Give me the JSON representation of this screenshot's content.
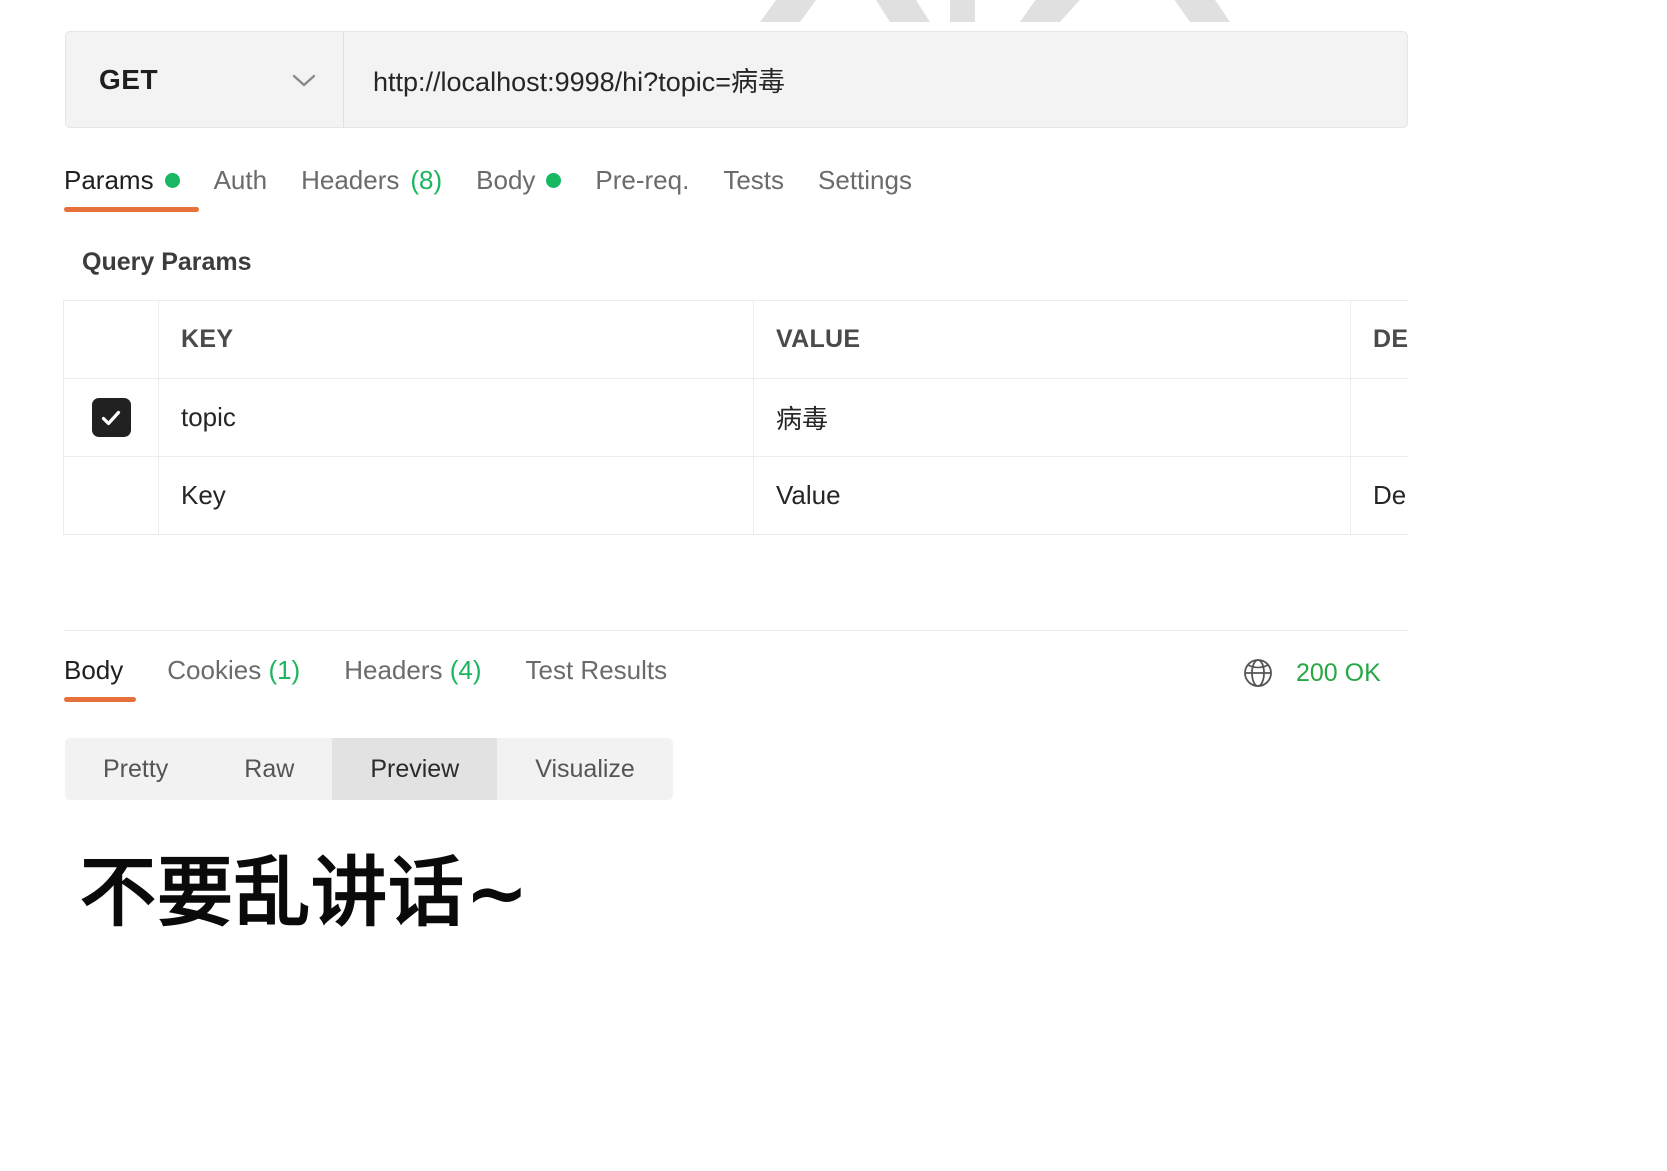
{
  "request": {
    "method": "GET",
    "method_chevron_icon": "chevron-down-icon",
    "url": "http://localhost:9998/hi?topic=病毒",
    "tabs": [
      {
        "label": "Params",
        "has_dot": true,
        "active": true
      },
      {
        "label": "Auth",
        "has_dot": false,
        "active": false
      },
      {
        "label": "Headers",
        "count": "(8)",
        "has_dot": false,
        "active": false
      },
      {
        "label": "Body",
        "has_dot": true,
        "active": false
      },
      {
        "label": "Pre-req.",
        "has_dot": false,
        "active": false
      },
      {
        "label": "Tests",
        "has_dot": false,
        "active": false
      },
      {
        "label": "Settings",
        "has_dot": false,
        "active": false
      }
    ]
  },
  "query_params": {
    "section_title": "Query Params",
    "columns": {
      "key": "KEY",
      "value": "VALUE",
      "description": "DE"
    },
    "rows": [
      {
        "checked": true,
        "check_icon": "checkmark-icon",
        "key": "topic",
        "value": "病毒",
        "description": ""
      }
    ],
    "placeholder_row": {
      "key": "Key",
      "value": "Value",
      "description": "De"
    }
  },
  "response": {
    "tabs": [
      {
        "label": "Body",
        "active": true
      },
      {
        "label": "Cookies",
        "count": "(1)",
        "active": false
      },
      {
        "label": "Headers",
        "count": "(4)",
        "active": false
      },
      {
        "label": "Test Results",
        "active": false
      }
    ],
    "status": {
      "globe_icon": "globe-icon",
      "text": "200 OK"
    },
    "view_modes": [
      {
        "label": "Pretty",
        "active": false
      },
      {
        "label": "Raw",
        "active": false
      },
      {
        "label": "Preview",
        "active": true
      },
      {
        "label": "Visualize",
        "active": false
      }
    ],
    "preview_text": "不要乱讲话~"
  },
  "colors": {
    "accent_orange": "#e8703a",
    "status_green": "#28a745",
    "dot_green": "#18b863",
    "count_green": "#1bb65f",
    "checkbox_dark": "#212121",
    "field_bg": "#f3f3f3",
    "segment_bg": "#f2f2f2",
    "segment_active_bg": "#e2e2e2"
  }
}
